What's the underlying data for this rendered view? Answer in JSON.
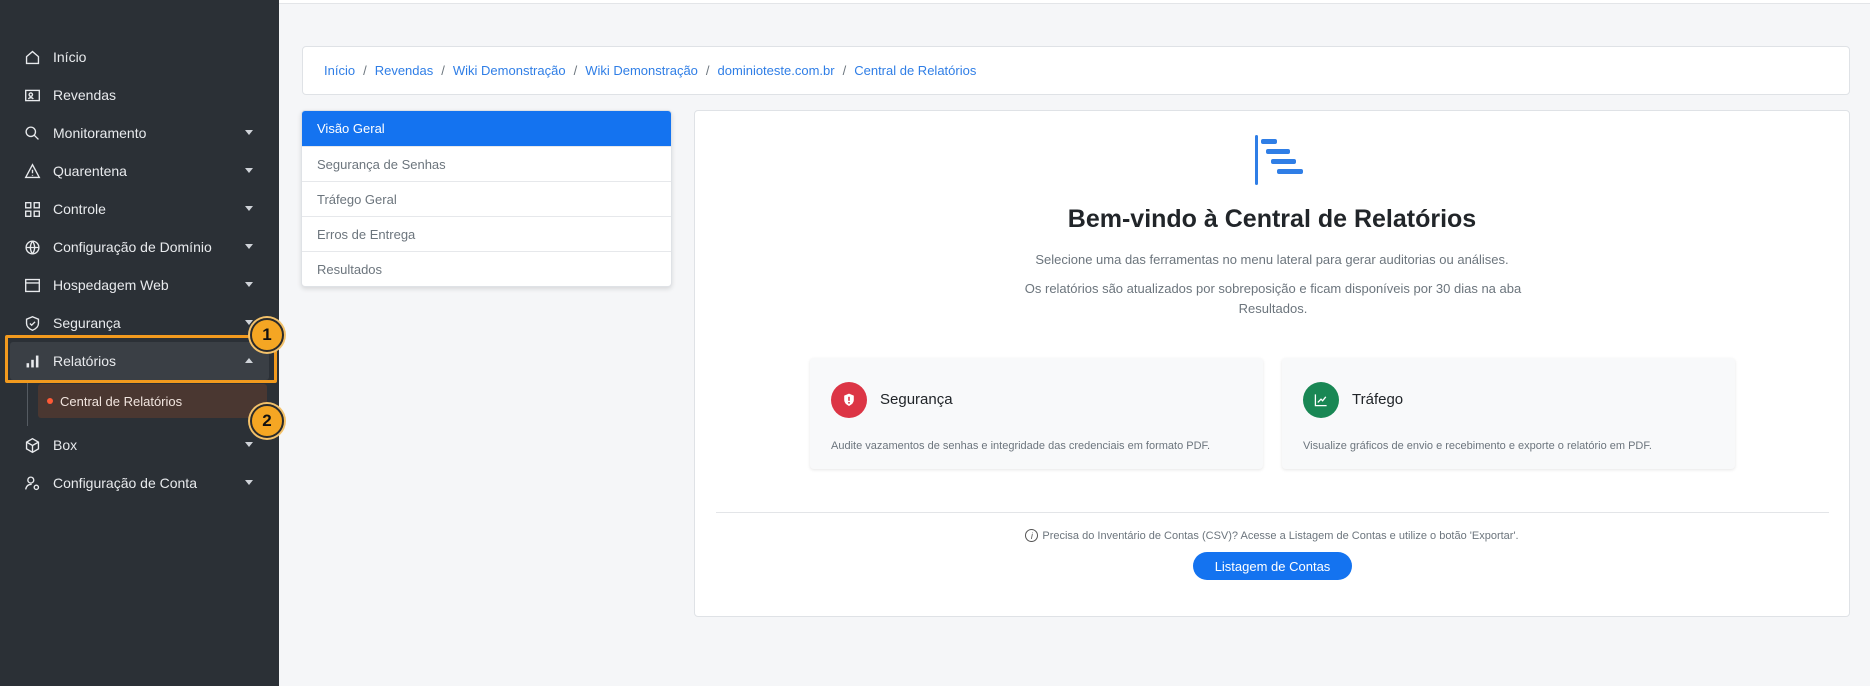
{
  "sidebar": {
    "items": [
      {
        "label": "Início",
        "icon": "home-icon"
      },
      {
        "label": "Revendas",
        "icon": "id-card-icon"
      },
      {
        "label": "Monitoramento",
        "icon": "search-icon"
      },
      {
        "label": "Quarentena",
        "icon": "warning-icon"
      },
      {
        "label": "Controle",
        "icon": "grid-icon"
      },
      {
        "label": "Configuração de Domínio",
        "icon": "globe-icon"
      },
      {
        "label": "Hospedagem Web",
        "icon": "browser-icon"
      },
      {
        "label": "Segurança",
        "icon": "shield-icon"
      },
      {
        "label": "Relatórios",
        "icon": "bar-chart-icon"
      },
      {
        "label": "Box",
        "icon": "box-icon"
      },
      {
        "label": "Configuração de Conta",
        "icon": "user-gear-icon"
      }
    ],
    "sub_item": "Central de Relatórios",
    "badges": [
      "1",
      "2"
    ],
    "accent": "#f29a1e"
  },
  "breadcrumb": [
    "Início",
    "Revendas",
    "Wiki Demonstração",
    "Wiki Demonstração",
    "dominioteste.com.br",
    "Central de Relatórios"
  ],
  "menu": [
    "Visão Geral",
    "Segurança de Senhas",
    "Tráfego Geral",
    "Erros de Entrega",
    "Resultados"
  ],
  "main": {
    "title": "Bem-vindo à Central de Relatórios",
    "subtitle": "Selecione uma das ferramentas no menu lateral para gerar auditorias ou análises.",
    "subtitle2": "Os relatórios são atualizados por sobreposição e ficam disponíveis por 30 dias na aba Resultados.",
    "cards": [
      {
        "title": "Segurança",
        "desc": "Audite vazamentos de senhas e integridade das credenciais em formato PDF.",
        "color": "#dc3545",
        "icon": "shield-alert-icon"
      },
      {
        "title": "Tráfego",
        "desc": "Visualize gráficos de envio e recebimento e exporte o relatório em PDF.",
        "color": "#198754",
        "icon": "trend-chart-icon"
      }
    ],
    "info": "Precisa do Inventário de Contas (CSV)? Acesse a Listagem de Contas e utilize o botão 'Exportar'.",
    "button": "Listagem de Contas"
  }
}
